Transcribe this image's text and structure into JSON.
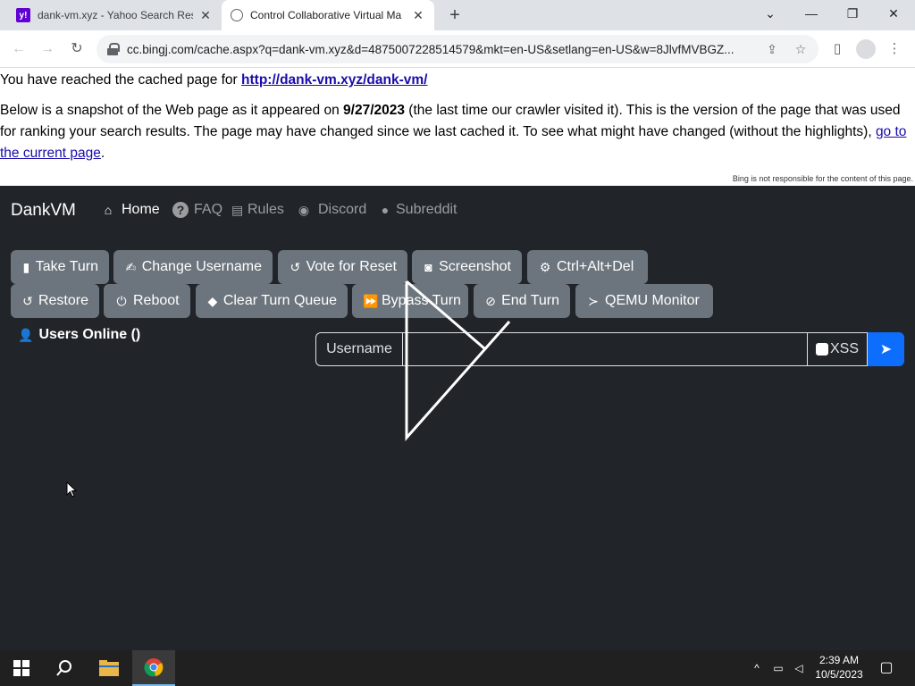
{
  "browser": {
    "tabs": [
      {
        "title": "dank-vm.xyz - Yahoo Search Resu",
        "favicon": "yahoo-icon",
        "active": false
      },
      {
        "title": "Control Collaborative Virtual Ma",
        "favicon": "globe-icon",
        "active": true
      }
    ],
    "new_tab": "+",
    "url": "cc.bingj.com/cache.aspx?q=dank-vm.xyz&d=4875007228514579&mkt=en-US&setlang=en-US&w=8JlvfMVBGZ..."
  },
  "cache": {
    "intro": "You have reached the cached page for ",
    "cached_url": "http://dank-vm.xyz/dank-vm/",
    "para_a": "Below is a snapshot of the Web page as it appeared on ",
    "date": "9/27/2023",
    "para_b": " (the last time our crawler visited it). This is the version of the page that was used for ranking your search results. The page may have changed since we last cached it. To see what might have changed (without the highlights), ",
    "current_link": "go to the current page",
    "para_end": ".",
    "disclaimer": "Bing is not responsible for the content of this page."
  },
  "app": {
    "brand": "DankVM",
    "nav": [
      {
        "label": "Home",
        "icon": "home-icon",
        "active": true
      },
      {
        "label": "FAQ",
        "icon": "question-icon",
        "active": false
      },
      {
        "label": "Rules",
        "icon": "clipboard-icon",
        "active": false
      },
      {
        "label": "Discord",
        "icon": "discord-icon",
        "active": false
      },
      {
        "label": "Subreddit",
        "icon": "reddit-icon",
        "active": false
      }
    ],
    "buttons_row1": [
      {
        "label": "Take Turn",
        "icon": "computer-mouse-icon"
      },
      {
        "label": "Change Username",
        "icon": "signature-icon"
      },
      {
        "label": "Vote for Reset",
        "icon": "rotate-left-icon"
      },
      {
        "label": "Screenshot",
        "icon": "camera-icon"
      },
      {
        "label": "Ctrl+Alt+Del",
        "icon": "gear-icon"
      }
    ],
    "buttons_row2": [
      {
        "label": "Restore",
        "icon": "rotate-left-icon"
      },
      {
        "label": "Reboot",
        "icon": "power-icon"
      },
      {
        "label": "Clear Turn Queue",
        "icon": "eraser-icon"
      },
      {
        "label": "Bypass Turn",
        "icon": "forward-icon"
      },
      {
        "label": "End Turn",
        "icon": "ban-icon"
      },
      {
        "label": "QEMU Monitor",
        "icon": "terminal-icon"
      }
    ],
    "users_online": "Users Online ()",
    "chat": {
      "username_label": "Username",
      "message_value": "",
      "xss_label": "XSS"
    }
  },
  "taskbar": {
    "time": "2:39 AM",
    "date": "10/5/2023"
  }
}
